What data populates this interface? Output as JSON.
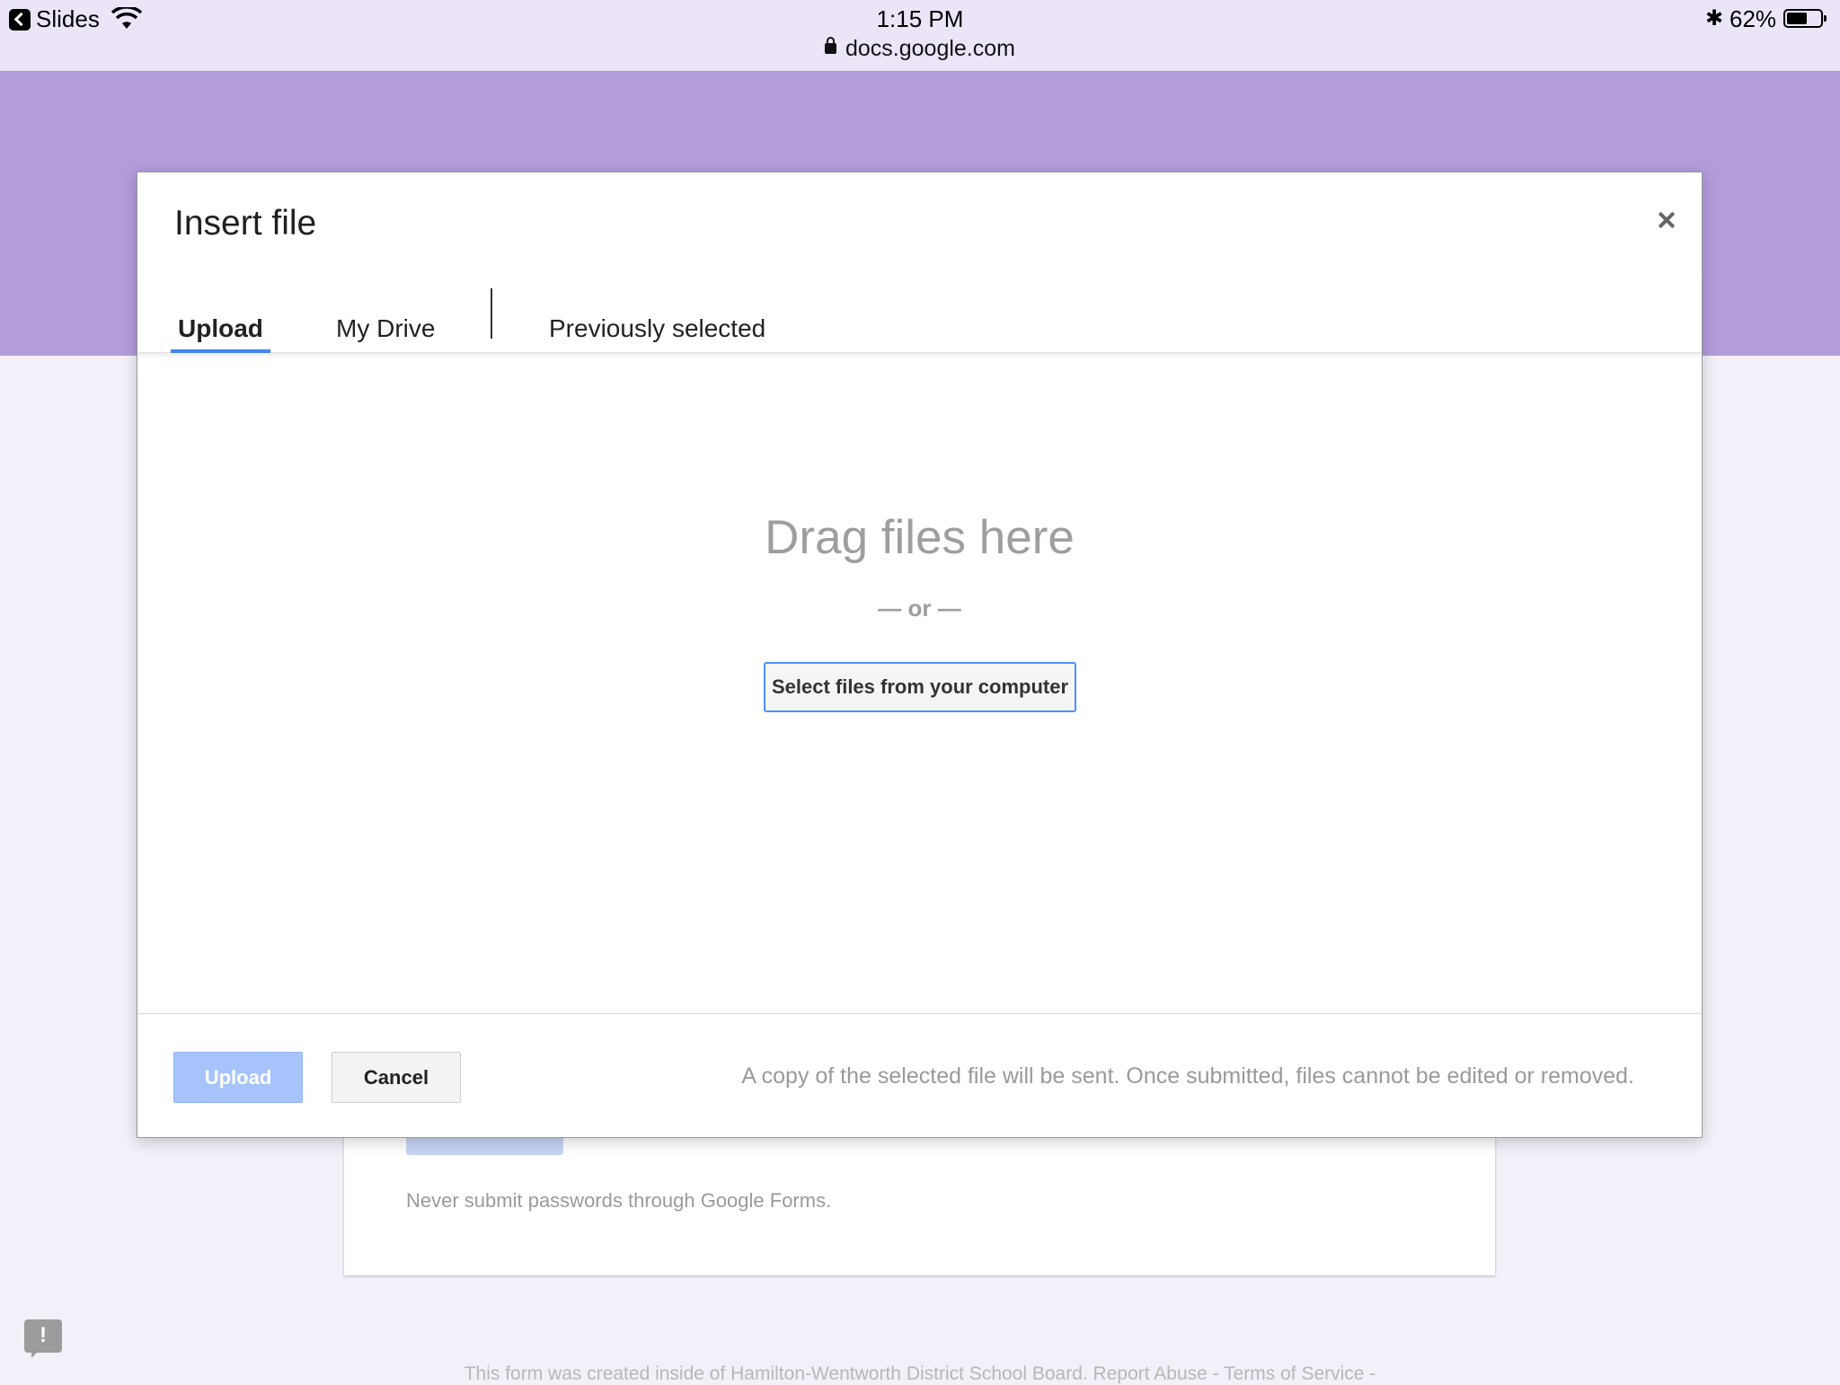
{
  "status_bar": {
    "back_app": "Slides",
    "time": "1:15 PM",
    "url": "docs.google.com",
    "battery_percent": "62%",
    "battery_level": 0.62,
    "icons": [
      "back-arrow-icon",
      "wifi-icon",
      "lock-icon",
      "bluetooth-icon",
      "battery-icon"
    ]
  },
  "background_page": {
    "note": "Never submit passwords through Google Forms.",
    "footer": "This form was created inside of Hamilton-Wentworth District School Board. Report Abuse - Terms of Service -",
    "report_icon": "exclamation-icon",
    "header_color": "#b29cda"
  },
  "dialog": {
    "title": "Insert file",
    "close_icon": "close-icon",
    "tabs": [
      {
        "label": "Upload",
        "active": true
      },
      {
        "label": "My Drive",
        "active": false
      },
      {
        "label": "Previously selected",
        "active": false
      }
    ],
    "drop_title": "Drag files here",
    "drop_or": "— or —",
    "select_button": "Select files from your computer",
    "upload_button": "Upload",
    "cancel_button": "Cancel",
    "notice": "A copy of the selected file will be sent. Once submitted, files cannot be edited or removed.",
    "accent_color": "#4285f4"
  }
}
